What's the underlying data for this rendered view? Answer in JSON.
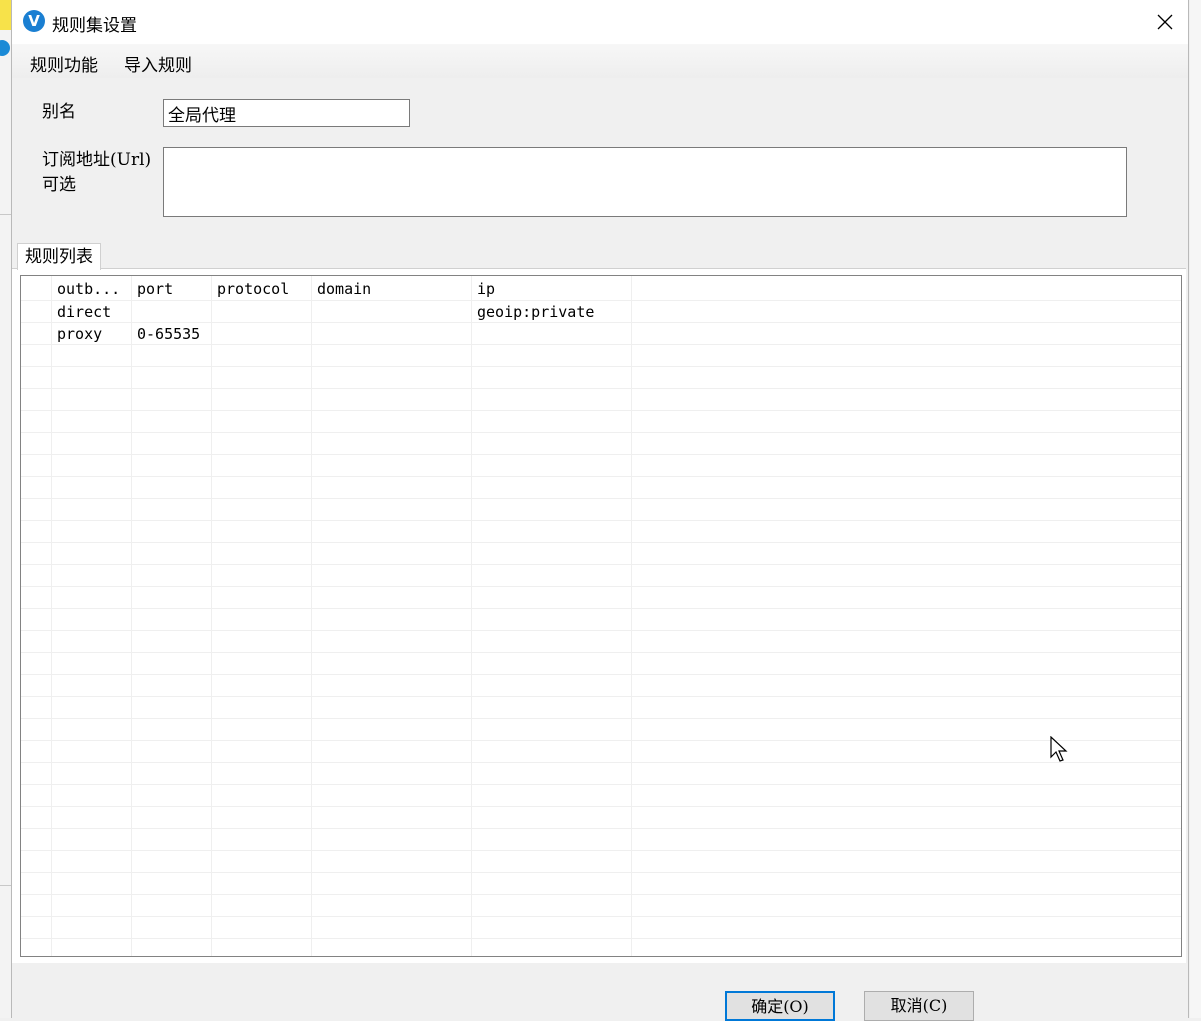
{
  "window": {
    "title": "规则集设置",
    "icon": "v-logo-icon"
  },
  "menu": {
    "items": [
      "规则功能",
      "导入规则"
    ]
  },
  "form": {
    "alias_label": "别名",
    "alias_value": "全局代理",
    "url_label_line1": "订阅地址(Url)",
    "url_label_line2": "可选",
    "url_value": ""
  },
  "tab": {
    "label": "规则列表"
  },
  "table": {
    "columns": [
      "outb...",
      "port",
      "protocol",
      "domain",
      "ip"
    ],
    "rows": [
      {
        "outbound": "direct",
        "port": "",
        "protocol": "",
        "domain": "",
        "ip": "geoip:private"
      },
      {
        "outbound": "proxy",
        "port": "0-65535",
        "protocol": "",
        "domain": "",
        "ip": ""
      }
    ]
  },
  "buttons": {
    "ok": "确定(O)",
    "cancel": "取消(C)"
  },
  "colors": {
    "accent": "#0078d7",
    "app_icon": "#1a7fd2"
  }
}
